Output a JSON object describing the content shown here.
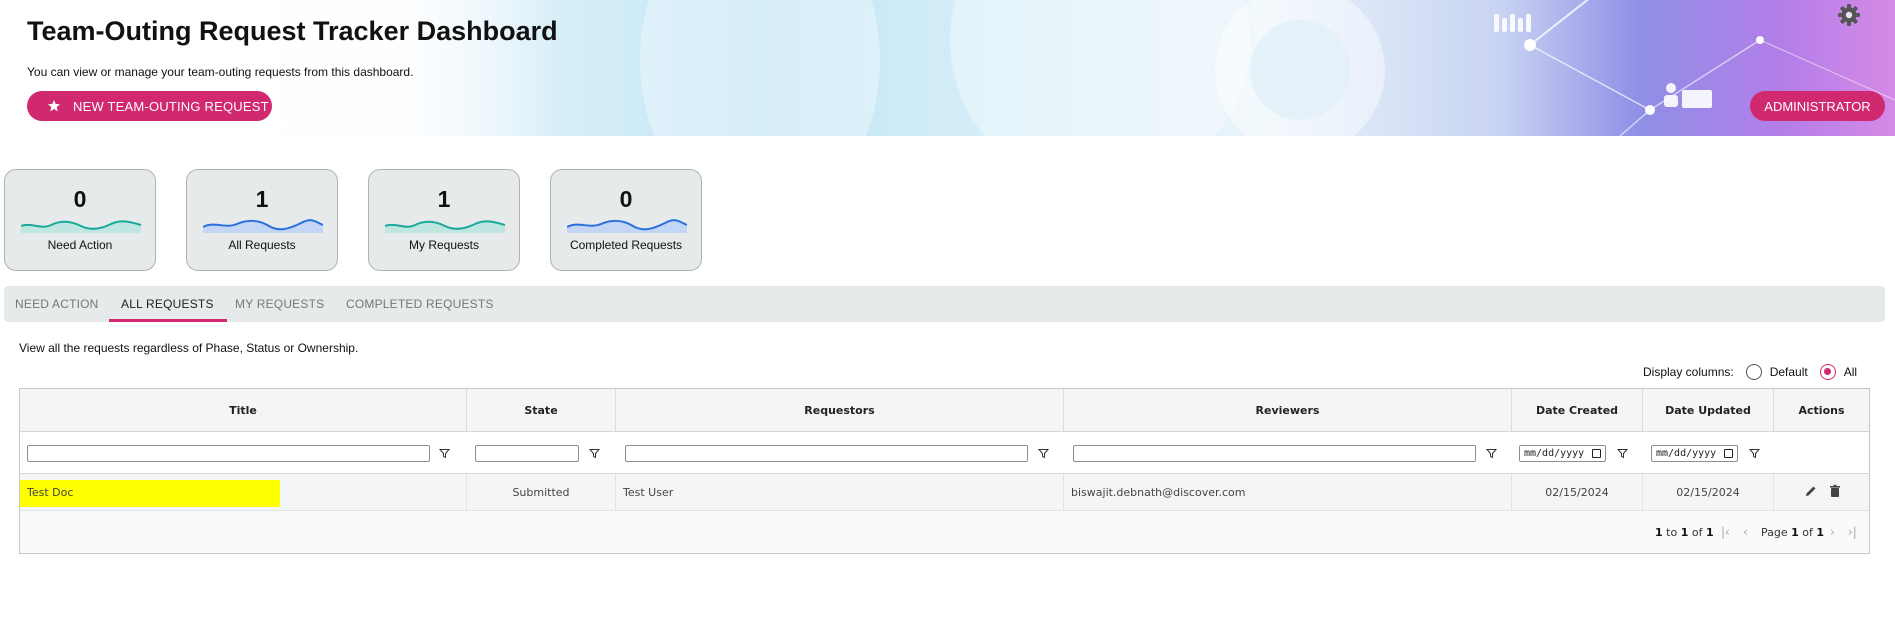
{
  "header": {
    "title": "Team-Outing Request Tracker Dashboard",
    "subtitle": "You can view or manage your team-outing requests from this dashboard.",
    "new_request_label": "NEW TEAM-OUTING REQUEST",
    "admin_label": "ADMINISTRATOR"
  },
  "stats": [
    {
      "value": "0",
      "label": "Need Action"
    },
    {
      "value": "1",
      "label": "All Requests"
    },
    {
      "value": "1",
      "label": "My Requests"
    },
    {
      "value": "0",
      "label": "Completed Requests"
    }
  ],
  "tabs": [
    {
      "label": "NEED ACTION"
    },
    {
      "label": "ALL REQUESTS"
    },
    {
      "label": "MY REQUESTS"
    },
    {
      "label": "COMPLETED REQUESTS"
    }
  ],
  "active_tab": "ALL REQUESTS",
  "tab_description": "View all the requests regardless of Phase, Status or Ownership.",
  "display_columns": {
    "label": "Display columns:",
    "options": [
      "Default",
      "All"
    ],
    "selected": "All"
  },
  "grid": {
    "columns": [
      "Title",
      "State",
      "Requestors",
      "Reviewers",
      "Date Created",
      "Date Updated",
      "Actions"
    ],
    "date_placeholder": "mm/dd/yyyy",
    "rows": [
      {
        "title": "Test Doc",
        "state": "Submitted",
        "requestors": "Test User",
        "reviewers": "biswajit.debnath@discover.com",
        "date_created": "02/15/2024",
        "date_updated": "02/15/2024"
      }
    ],
    "pager": {
      "range_from": "1",
      "range_to_word": "to",
      "range_to": "1",
      "of_word": "of",
      "total": "1",
      "page_word": "Page",
      "page": "1",
      "pages": "1"
    }
  },
  "colors": {
    "accent": "#d1296f",
    "card_bg": "#e7eaeb",
    "highlight": "#ffff00",
    "wave_teal": "#1aa89a",
    "wave_blue": "#2a6fe0"
  }
}
